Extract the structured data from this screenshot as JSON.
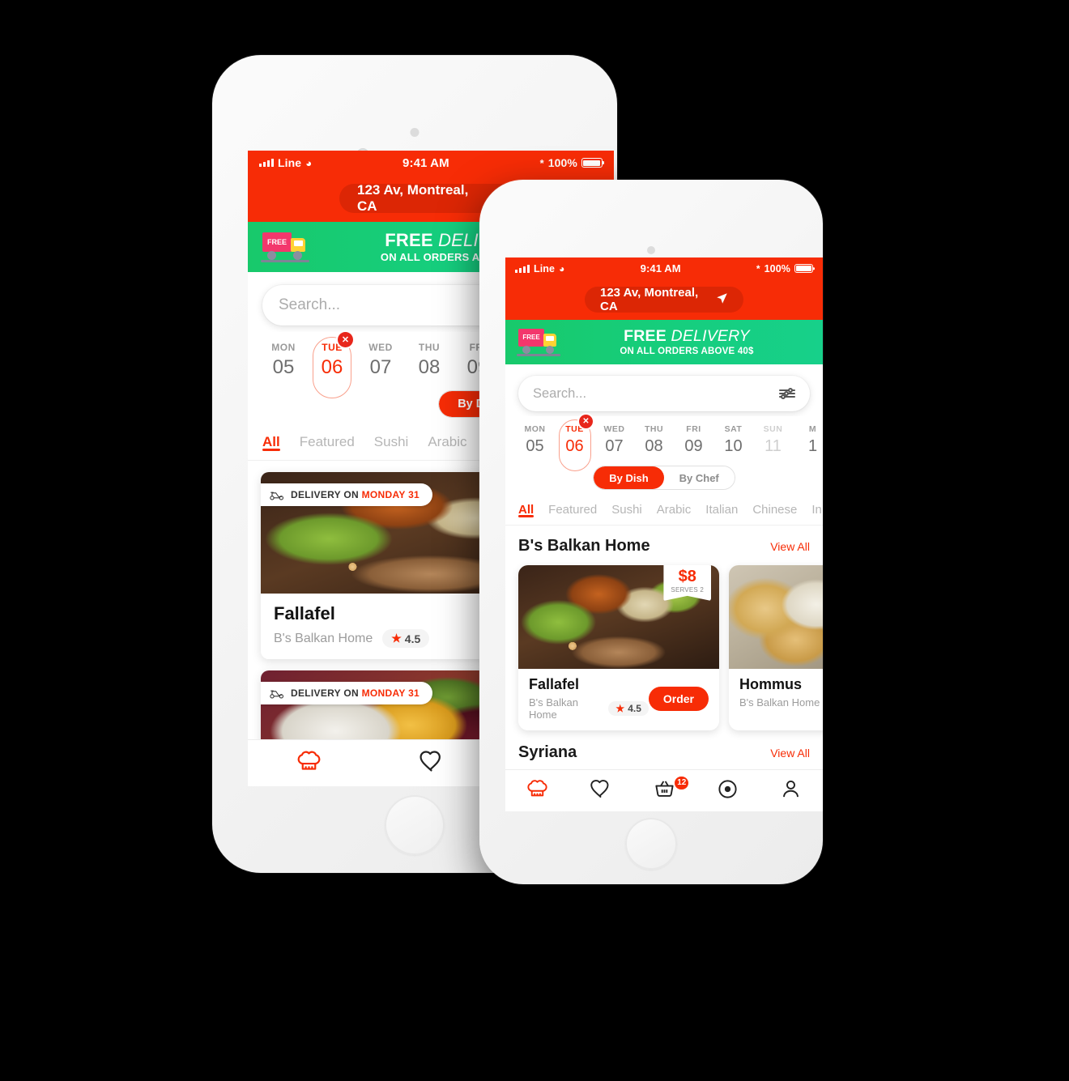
{
  "colors": {
    "brand_red": "#F72C06",
    "banner_green": "#18C96B",
    "badge_red": "#E8261B",
    "muted_gray": "#9A9A9A"
  },
  "status_bar": {
    "carrier": "Line",
    "time": "9:41 AM",
    "battery_percent": "100%"
  },
  "nav": {
    "menu_icon": "hamburger-icon",
    "address": "123 Av, Montreal, CA",
    "locate_icon": "location-arrow-icon"
  },
  "banner": {
    "truck_label": "FREE",
    "line1_strong": "FREE",
    "line1_rest": " DELIVERY",
    "line2_prefix": "ON ALL ORDERS ABOVE ",
    "line2_strong": "40$"
  },
  "search": {
    "placeholder": "Search...",
    "filter_icon": "sliders-filter-icon"
  },
  "dates": [
    {
      "dow": "MON",
      "num": "05",
      "state": "normal"
    },
    {
      "dow": "TUE",
      "num": "06",
      "state": "selected"
    },
    {
      "dow": "WED",
      "num": "07",
      "state": "normal"
    },
    {
      "dow": "THU",
      "num": "08",
      "state": "normal"
    },
    {
      "dow": "FRI",
      "num": "09",
      "state": "normal"
    },
    {
      "dow": "SAT",
      "num": "10",
      "state": "normal"
    },
    {
      "dow": "SUN",
      "num": "11",
      "state": "dim"
    },
    {
      "dow": "M",
      "num": "1",
      "state": "normal"
    }
  ],
  "date_clear_badge": "✕",
  "toggle": {
    "options": [
      "By Dish",
      "By Chef"
    ],
    "selected": "By Dish"
  },
  "categories": {
    "items": [
      "All",
      "Featured",
      "Sushi",
      "Arabic",
      "Italian",
      "Chinese",
      "In"
    ],
    "selected": "All"
  },
  "front_phone": {
    "sections": [
      {
        "title": "B's Balkan Home",
        "view_all": "View All",
        "dishes": [
          {
            "name": "Fallafel",
            "restaurant": "B's Balkan Home",
            "rating": "4.5",
            "star": "★",
            "price": "$8",
            "serves": "SERVES 2",
            "order_label": "Order",
            "image": "fallafel-photo"
          },
          {
            "name": "Hommus",
            "restaurant": "B's Balkan Home",
            "rating": "",
            "star": "",
            "price": "",
            "serves": "",
            "order_label": "",
            "image": "hommus-photo"
          }
        ]
      },
      {
        "title": "Syriana",
        "view_all": "View All",
        "dishes": []
      }
    ]
  },
  "back_phone": {
    "cards": [
      {
        "delivery_prefix": "DELIVERY ON ",
        "delivery_day": "MONDAY 31",
        "name": "Fallafel",
        "restaurant": "B's Balkan Home",
        "rating": "4.5",
        "star": "★",
        "image": "fallafel-photo"
      },
      {
        "delivery_prefix": "DELIVERY ON ",
        "delivery_day": "MONDAY 31",
        "name": "",
        "restaurant": "",
        "rating": "",
        "star": "",
        "image": "vegetables-photo"
      }
    ]
  },
  "tabbar": {
    "items": [
      {
        "icon": "chef-hat-icon",
        "active": true,
        "badge": ""
      },
      {
        "icon": "heart-icon",
        "active": false,
        "badge": ""
      },
      {
        "icon": "basket-icon",
        "active": false,
        "badge": "12"
      },
      {
        "icon": "record-circle-icon",
        "active": false,
        "badge": ""
      },
      {
        "icon": "user-icon",
        "active": false,
        "badge": ""
      }
    ],
    "front_item_count": 5,
    "back_item_count": 3
  }
}
